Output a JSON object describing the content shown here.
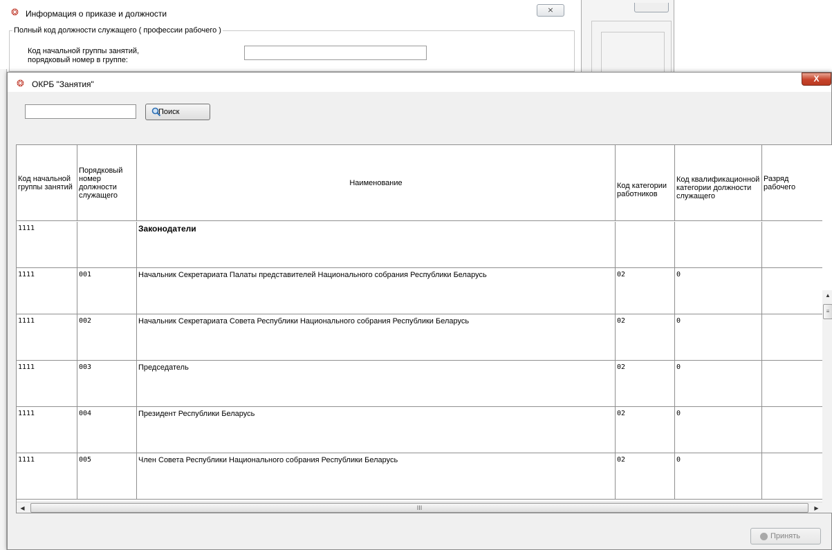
{
  "background_window": {
    "title": "Информация о приказе и должности",
    "close_label": "⨯",
    "group_legend": "Полный код должности служащего ( профессии рабочего )",
    "code_label_line1": "Код начальной группы занятий,",
    "code_label_line2": "порядковый номер в группе:",
    "code_value": ""
  },
  "dialog": {
    "title": "ОКРБ \"Занятия\"",
    "close_label": "X",
    "search_value": "",
    "search_button": "Поиск",
    "accept_button": "Принять"
  },
  "grid": {
    "columns": [
      "Код начальной группы занятий",
      "Порядковый номер должности служащего",
      "Наименование",
      "Код категории работников",
      "Код квалификационной категории должности служащего",
      "Разряд рабочего"
    ],
    "rows": [
      {
        "group": "1111",
        "number": "",
        "name": "Законодатели",
        "category": "",
        "qual": "",
        "grade": "",
        "bold": true
      },
      {
        "group": "1111",
        "number": "001",
        "name": "Начальник Секретариата Палаты представителей Национального собрания Республики Беларусь",
        "category": "02",
        "qual": "0",
        "grade": ""
      },
      {
        "group": "1111",
        "number": "002",
        "name": "Начальник Секретариата Совета Республики Национального собрания Республики Беларусь",
        "category": "02",
        "qual": "0",
        "grade": ""
      },
      {
        "group": "1111",
        "number": "003",
        "name": "Председатель",
        "category": "02",
        "qual": "0",
        "grade": ""
      },
      {
        "group": "1111",
        "number": "004",
        "name": "Президент Республики Беларусь",
        "category": "02",
        "qual": "0",
        "grade": ""
      },
      {
        "group": "1111",
        "number": "005",
        "name": "Член Совета Республики Национального собрания Республики Беларусь",
        "category": "02",
        "qual": "0",
        "grade": ""
      }
    ]
  },
  "icons": {
    "app_icon": "app-logo-icon",
    "search_icon": "magnifier-icon",
    "accept_icon": "circle-icon"
  },
  "colors": {
    "close_button": "#c7432a",
    "app_icon": "#c0392b"
  }
}
